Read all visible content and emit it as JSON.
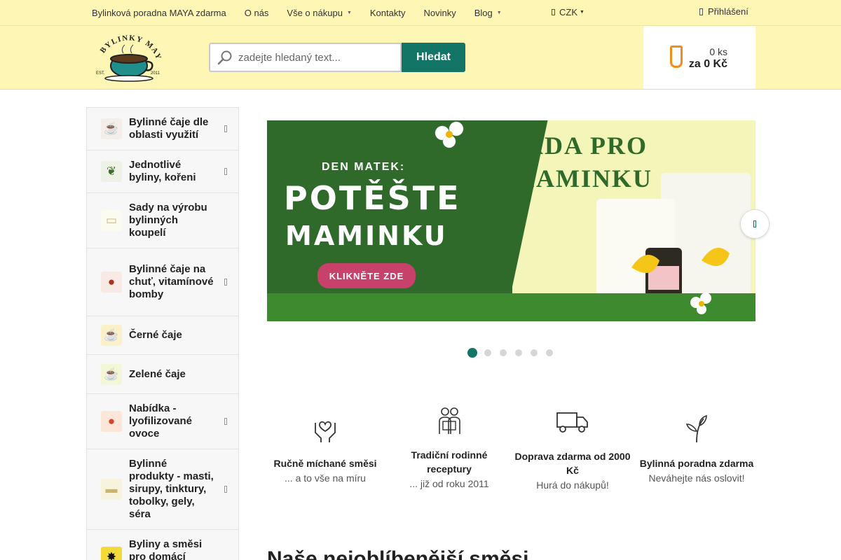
{
  "topnav": {
    "items": [
      {
        "label": "Bylinková poradna MAYA zdarma",
        "caret": false
      },
      {
        "label": "O nás",
        "caret": false
      },
      {
        "label": "Vše o nákupu",
        "caret": true
      },
      {
        "label": "Kontakty",
        "caret": false
      },
      {
        "label": "Novinky",
        "caret": false
      },
      {
        "label": "Blog",
        "caret": true
      }
    ],
    "currency": "CZK",
    "login": "Přihlášení"
  },
  "header": {
    "logo_text": "BYLINKY MAYA",
    "logo_est": "EST.",
    "logo_year": "2011",
    "search": {
      "placeholder": "zadejte hledaný text...",
      "button": "Hledat"
    },
    "cart": {
      "quantity": "0 ks",
      "total": "za 0 Kč"
    }
  },
  "sidebar": {
    "categories": [
      {
        "label": "Bylinné čaje dle oblasti využití",
        "has_submenu": true,
        "icon": "tea-cup-icon"
      },
      {
        "label": "Jednotlivé byliny, kořeni",
        "has_submenu": true,
        "icon": "herb-icon"
      },
      {
        "label": "Sady na výrobu bylinných koupelí",
        "has_submenu": false,
        "icon": "bathtub-icon"
      },
      {
        "label": "Bylinné čaje na chuť, vitamínové bomby",
        "has_submenu": true,
        "icon": "fruit-tea-icon"
      },
      {
        "label": "Černé čaje",
        "has_submenu": false,
        "icon": "black-tea-icon"
      },
      {
        "label": "Zelené čaje",
        "has_submenu": false,
        "icon": "green-tea-icon"
      },
      {
        "label": "Nabídka - lyofilizované ovoce",
        "has_submenu": true,
        "icon": "fruit-icon"
      },
      {
        "label": "Bylinné produkty - masti, sirupy, tinktury, tobolky, gely, séra",
        "has_submenu": true,
        "icon": "ointment-icon"
      },
      {
        "label": "Byliny a směsi pro domácí",
        "has_submenu": true,
        "icon": "paw-icon"
      }
    ]
  },
  "banner": {
    "kicker": "DEN MATEK:",
    "headline_1": "POTĚŠTE",
    "headline_2": "MAMINKU",
    "cta": "KLIKNĚTE ZDE",
    "right_1": "SADA PRO",
    "right_2": "MAMINKU",
    "slides": 6,
    "active_slide": 1
  },
  "features": [
    {
      "title": "Ručně míchané směsi",
      "subtitle": "... a to vše na míru",
      "icon": "hands-heart-icon"
    },
    {
      "title": "Tradiční rodinné receptury",
      "subtitle": "... již od roku 2011",
      "icon": "family-icon"
    },
    {
      "title": "Doprava zdarma od 2000 Kč",
      "subtitle": "Hurá do nákupů!",
      "icon": "truck-icon"
    },
    {
      "title": "Bylinná poradna zdarma",
      "subtitle": "Neváhejte nás oslovit!",
      "icon": "leaf-icon"
    }
  ],
  "section_title": "Naše nejoblíbenější směsi",
  "colors": {
    "accent": "#137565",
    "header_bg": "#fdf6b4",
    "cart_icon": "#f28c1a",
    "banner_green": "#2f6a2b"
  }
}
